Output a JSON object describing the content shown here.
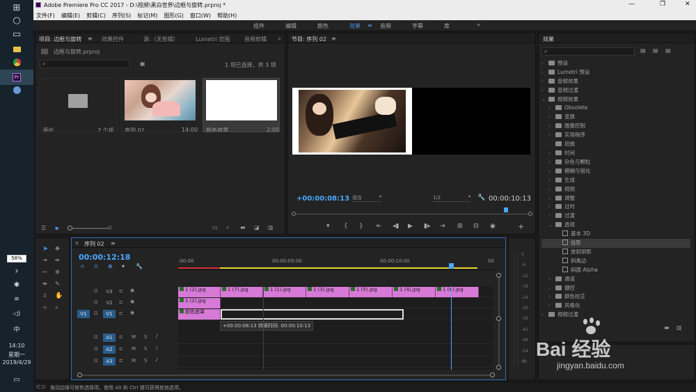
{
  "app": {
    "title": "Adobe Premiere Pro CC 2017 - D:\\视频\\黑白世界\\边框与旋转.prproj *"
  },
  "menu": [
    "文件(F)",
    "编辑(E)",
    "剪辑(C)",
    "序列(S)",
    "标记(M)",
    "图形(G)",
    "窗口(W)",
    "帮助(H)"
  ],
  "workspaces": [
    "组件",
    "编辑",
    "颜色",
    "效果",
    "音频",
    "字幕",
    "库"
  ],
  "project": {
    "tab": "项目: 边框与旋转",
    "tabs": [
      "效果控件",
      "源:（无剪辑）",
      "Lumetri 范围",
      "音频剪辑"
    ],
    "file": "边框与旋转.prproj",
    "status": "1 项已选择，共 3 项",
    "items": [
      {
        "name": "图片",
        "meta": "7 个项"
      },
      {
        "name": "序列 02",
        "meta": "14:00"
      },
      {
        "name": "颜色遮罩",
        "meta": "2:00"
      }
    ]
  },
  "program": {
    "tab": "节目: 序列 02",
    "timecode": "+00:00:08:13",
    "fit": "适合",
    "zoom": "1/2",
    "duration": "00:00:10:13"
  },
  "effects": {
    "title": "效果",
    "tree": [
      {
        "label": "预设",
        "indent": 0,
        "icon": "folder-icon",
        "open": false
      },
      {
        "label": "Lumetri 预设",
        "indent": 0,
        "icon": "folder-icon",
        "open": false
      },
      {
        "label": "音频效果",
        "indent": 0,
        "icon": "folder-icon",
        "open": false
      },
      {
        "label": "音频过渡",
        "indent": 0,
        "icon": "folder-icon",
        "open": false
      },
      {
        "label": "视频效果",
        "indent": 0,
        "icon": "folder-icon",
        "open": true
      },
      {
        "label": "Obsolete",
        "indent": 1,
        "icon": "folder-icon",
        "open": false
      },
      {
        "label": "变换",
        "indent": 1,
        "icon": "folder-icon",
        "open": false
      },
      {
        "label": "图像控制",
        "indent": 1,
        "icon": "folder-icon",
        "open": false
      },
      {
        "label": "实用程序",
        "indent": 1,
        "icon": "folder-icon",
        "open": false
      },
      {
        "label": "扭曲",
        "indent": 1,
        "icon": "folder-icon",
        "open": false
      },
      {
        "label": "时间",
        "indent": 1,
        "icon": "folder-icon",
        "open": false
      },
      {
        "label": "杂色与颗粒",
        "indent": 1,
        "icon": "folder-icon",
        "open": false
      },
      {
        "label": "模糊与锐化",
        "indent": 1,
        "icon": "folder-icon",
        "open": false
      },
      {
        "label": "生成",
        "indent": 1,
        "icon": "folder-icon",
        "open": false
      },
      {
        "label": "视频",
        "indent": 1,
        "icon": "folder-icon",
        "open": false
      },
      {
        "label": "调整",
        "indent": 1,
        "icon": "folder-icon",
        "open": false
      },
      {
        "label": "过时",
        "indent": 1,
        "icon": "folder-icon",
        "open": false
      },
      {
        "label": "过渡",
        "indent": 1,
        "icon": "folder-icon",
        "open": false
      },
      {
        "label": "透视",
        "indent": 1,
        "icon": "folder-icon",
        "open": true
      },
      {
        "label": "基本 3D",
        "indent": 2,
        "icon": "effect-icon",
        "open": false
      },
      {
        "label": "投影",
        "indent": 2,
        "icon": "effect-icon",
        "open": false,
        "selected": true
      },
      {
        "label": "放射阴影",
        "indent": 2,
        "icon": "effect-icon",
        "open": false
      },
      {
        "label": "斜角边",
        "indent": 2,
        "icon": "effect-icon",
        "open": false
      },
      {
        "label": "斜面 Alpha",
        "indent": 2,
        "icon": "effect-icon",
        "open": false
      },
      {
        "label": "通道",
        "indent": 1,
        "icon": "folder-icon",
        "open": false
      },
      {
        "label": "键控",
        "indent": 1,
        "icon": "folder-icon",
        "open": false
      },
      {
        "label": "颜色校正",
        "indent": 1,
        "icon": "folder-icon",
        "open": false
      },
      {
        "label": "风格化",
        "indent": 1,
        "icon": "folder-icon",
        "open": false
      },
      {
        "label": "视频过渡",
        "indent": 0,
        "icon": "folder-icon",
        "open": false
      }
    ]
  },
  "timeline": {
    "tab": "序列 02",
    "timecode": "00:00:12:18",
    "ruler": [
      ":00:00",
      "00:00:05:00",
      "00:00:10:00",
      "00"
    ],
    "tracks": [
      {
        "name": "V3",
        "type": "video"
      },
      {
        "name": "V2",
        "type": "video"
      },
      {
        "name": "V1",
        "type": "video",
        "source": "V1"
      },
      {
        "name": "A1",
        "type": "audio"
      },
      {
        "name": "A2",
        "type": "audio"
      },
      {
        "name": "A3",
        "type": "audio"
      }
    ],
    "master_value": "0.0",
    "v3_clips": [
      "1 (2).jpg",
      "1 (7).jpg",
      "1 (1).jpg",
      "1 (3).jpg",
      "1 (5).jpg",
      "1 (4).jpg",
      "1 (6).jpg"
    ],
    "v2_clip": "1 (2).jpg",
    "v1_clip": "颜色遮罩",
    "tooltip": "+00:00:08:13 持续时间: 00:00:10:13"
  },
  "meter": [
    "0",
    "-6",
    "-12",
    "-18",
    "-24",
    "-30",
    "-36",
    "-42",
    "-48",
    "-54",
    "dB"
  ],
  "status": "拖动边缘可修剪选择项。使用 Alt 和 Ctrl 键可获得其他选项。",
  "taskbar": {
    "battery": "58%",
    "time": "14:10",
    "weekday": "星期一",
    "date": "2019/4/29",
    "ime": "中"
  },
  "watermark": {
    "brand": "Bai 经验",
    "url": "jingyan.baidu.com"
  }
}
